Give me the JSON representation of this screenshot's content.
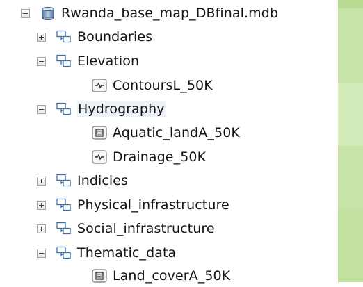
{
  "tree": {
    "root": {
      "label": "Rwanda_base_map_DBfinal.mdb",
      "icon": "geodatabase-icon",
      "expanded": true
    },
    "items": [
      {
        "label": "Boundaries",
        "icon": "feature-dataset-icon",
        "expanded": false
      },
      {
        "label": "Elevation",
        "icon": "feature-dataset-icon",
        "expanded": true
      },
      {
        "label": "ContoursL_50K",
        "icon": "line-feature-class-icon"
      },
      {
        "label": "Hydrography",
        "icon": "feature-dataset-icon",
        "expanded": true,
        "selected": true
      },
      {
        "label": "Aquatic_landA_50K",
        "icon": "polygon-feature-class-icon"
      },
      {
        "label": "Drainage_50K",
        "icon": "line-feature-class-icon"
      },
      {
        "label": "Indicies",
        "icon": "feature-dataset-icon",
        "expanded": false
      },
      {
        "label": "Physical_infrastructure",
        "icon": "feature-dataset-icon",
        "expanded": false
      },
      {
        "label": "Social_infrastructure",
        "icon": "feature-dataset-icon",
        "expanded": false
      },
      {
        "label": "Thematic_data",
        "icon": "feature-dataset-icon",
        "expanded": true
      },
      {
        "label": "Land_coverA_50K",
        "icon": "polygon-feature-class-icon"
      }
    ]
  },
  "colors": {
    "accent_strip": "#c9e4a8",
    "selection_highlight": "#eef3fa"
  }
}
